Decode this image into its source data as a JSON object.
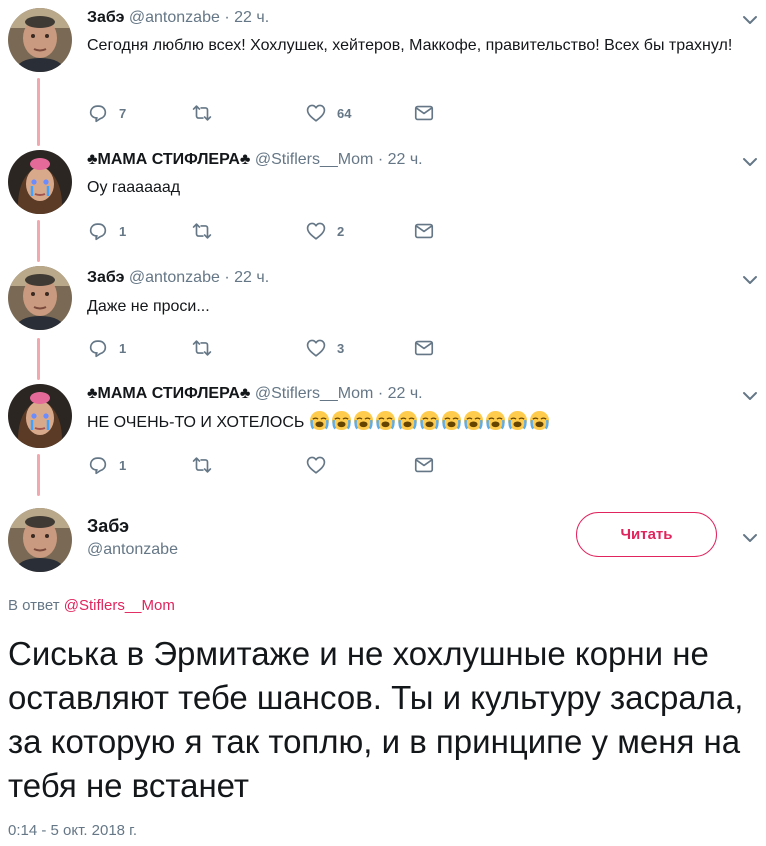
{
  "thread": [
    {
      "avatar": "avatar-zabe",
      "name": "Забэ",
      "handle": "@antonzabe",
      "dot": "·",
      "time": "22 ч.",
      "text": "Сегодня люблю всех! Хохлушек, хейтеров, Маккофе, правительство! Всех бы трахнул!",
      "replies": "7",
      "retweets": "",
      "likes": "64"
    },
    {
      "avatar": "avatar-stiflers-mom",
      "club": "♣",
      "name": "МАМА СТИФЛЕРА",
      "handle": "@Stiflers__Mom",
      "dot": "·",
      "time": "22 ч.",
      "text": "Оу гаааааад",
      "replies": "1",
      "retweets": "",
      "likes": "2"
    },
    {
      "avatar": "avatar-zabe",
      "name": "Забэ",
      "handle": "@antonzabe",
      "dot": "·",
      "time": "22 ч.",
      "text": "Даже не проси...",
      "replies": "1",
      "retweets": "",
      "likes": "3"
    },
    {
      "avatar": "avatar-stiflers-mom",
      "club": "♣",
      "name": "МАМА СТИФЛЕРА",
      "handle": "@Stiflers__Mom",
      "dot": "·",
      "time": "22 ч.",
      "text": "НЕ ОЧЕНЬ-ТО И ХОТЕЛОСЬ",
      "emoji_count": 11,
      "emoji": "loudly-crying-face",
      "replies": "1",
      "retweets": "",
      "likes": ""
    }
  ],
  "main_tweet": {
    "name": "Забэ",
    "handle": "@antonzabe",
    "follow_label": "Читать",
    "reply_prefix": "В ответ ",
    "reply_mention": "@Stiflers__Mom",
    "text": "Сиська в Эрмитаже и не хохлушные корни не оставляют тебе шансов. Ты и культуру засрала, за которую я так топлю, и в принципе у меня на тебя не встанет",
    "timestamp": "0:14 - 5 окт. 2018 г."
  },
  "colors": {
    "accent": "#e0245e",
    "thread_line": "#f2a9ad",
    "secondary_text": "#657786",
    "primary_text": "#14171a"
  },
  "icons": [
    "reply-icon",
    "retweet-icon",
    "heart-icon",
    "envelope-icon",
    "chevron-down-icon"
  ]
}
